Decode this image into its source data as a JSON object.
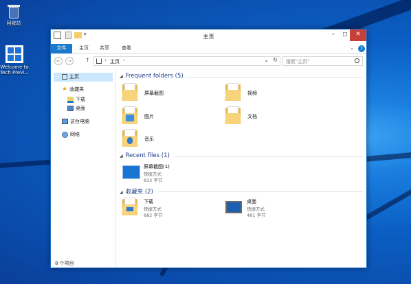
{
  "desktop": {
    "icons": [
      {
        "label": "回收站",
        "icon": "recycle-bin-icon"
      },
      {
        "label": "Welcome to Tech Previ...",
        "icon": "windows-logo-icon"
      }
    ]
  },
  "window": {
    "title": "主页",
    "controls": {
      "minimize": "–",
      "maximize": "☐",
      "close": "✕"
    },
    "ribbon_tabs": [
      "文件",
      "主页",
      "共享",
      "查看"
    ],
    "ribbon_expand": "⌄",
    "help": "?",
    "address": {
      "back": "←",
      "forward": "→",
      "up": "↑",
      "path": "主页",
      "dropdown": "⌄",
      "refresh": "↻"
    },
    "search": {
      "placeholder": "搜索\"主页\""
    },
    "nav": {
      "home": "主页",
      "favorites": "收藏夹",
      "downloads": "下载",
      "desktop": "桌面",
      "this_pc": "这台电脑",
      "network": "网络"
    },
    "status": "8 个项目",
    "sections": {
      "frequent": {
        "title": "Frequent folders (5)",
        "items": [
          {
            "name": "屏幕截图",
            "icon": "screenshots-folder-icon"
          },
          {
            "name": "视频",
            "icon": "videos-folder-icon"
          },
          {
            "name": "图片",
            "icon": "pictures-folder-icon"
          },
          {
            "name": "文档",
            "icon": "documents-folder-icon"
          },
          {
            "name": "音乐",
            "icon": "music-folder-icon"
          }
        ]
      },
      "recent": {
        "title": "Recent files (1)",
        "items": [
          {
            "name": "屏幕截图(1)",
            "type": "快捷方式",
            "size": "832 字节"
          }
        ]
      },
      "favorites": {
        "title": "收藏夹 (2)",
        "items": [
          {
            "name": "下载",
            "type": "快捷方式",
            "size": "882 字节"
          },
          {
            "name": "桌面",
            "type": "快捷方式",
            "size": "481 字节"
          }
        ]
      }
    }
  },
  "colors": {
    "accent": "#1979ca",
    "close": "#c7403a",
    "section_title": "#1e3c8c",
    "desktop": "#0b5fc4"
  }
}
